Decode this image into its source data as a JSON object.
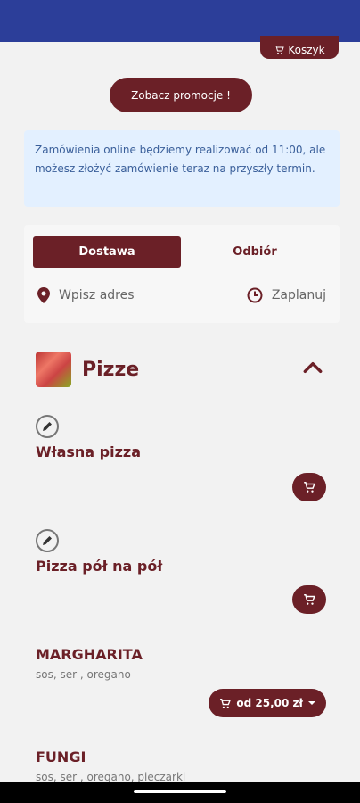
{
  "colors": {
    "brand": "#6b2027",
    "status_bar": "#2c3e99",
    "info_bg": "#e3f0ff"
  },
  "cart": {
    "label": "Koszyk",
    "icon": "cart-icon"
  },
  "promo": {
    "label": "Zobacz promocje !"
  },
  "info": {
    "text": "Zamówienia online będziemy realizować od 11:00, ale możesz złożyć zamówienie teraz na przyszły termin."
  },
  "order": {
    "tabs": [
      {
        "label": "Dostawa",
        "active": true
      },
      {
        "label": "Odbiór",
        "active": false
      }
    ],
    "address_placeholder": "Wpisz adres",
    "schedule_label": "Zaplanuj"
  },
  "category": {
    "title": "Pizze",
    "expanded": true
  },
  "items": [
    {
      "name": "Własna pizza",
      "icon": "pencil-icon"
    },
    {
      "name": "Pizza pół na pół",
      "icon": "pencil-icon"
    },
    {
      "name": "MARGHARITA",
      "description": "sos, ser , oregano",
      "price_label": "od 25,00 zł"
    },
    {
      "name": "FUNGI",
      "description": "sos, ser , oregano, pieczarki"
    }
  ]
}
